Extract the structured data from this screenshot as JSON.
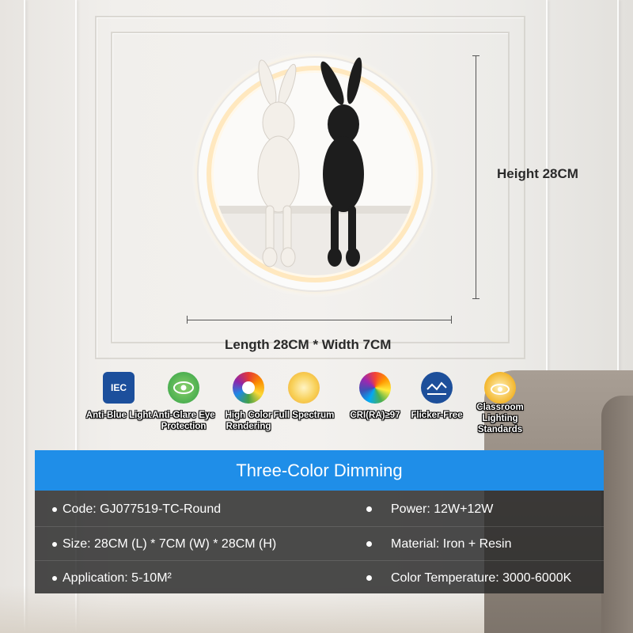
{
  "product": {
    "height_label": "Height 28CM",
    "size_label": "Length 28CM * Width 7CM"
  },
  "features": [
    {
      "icon": "iec-icon",
      "label": "Anti-Blue Light",
      "color": "#1c4f9c"
    },
    {
      "icon": "eye-protection-icon",
      "label": "Anti-Glare Eye Protection",
      "color": "#4caf50"
    },
    {
      "icon": "color-wheel-icon",
      "label": "High Color Rendering",
      "color": "#e91e63"
    },
    {
      "icon": "full-spectrum-sun-icon",
      "label": "Full Spectrum",
      "color": "#f5c33b"
    },
    {
      "icon": "cri-rainbow-icon",
      "label": "CRI(RA)≥97",
      "color": "#2fa7e0"
    },
    {
      "icon": "flicker-free-icon",
      "label": "Flicker-Free",
      "color": "#1d4f9a"
    },
    {
      "icon": "classroom-lighting-icon",
      "label": "Classroom Lighting Standards",
      "color": "#f3b62c"
    }
  ],
  "banner": {
    "title": "Three-Color Dimming",
    "color": "#1f8ee8"
  },
  "specs": {
    "code": "Code: GJ077519-TC-Round",
    "power": "Power: 12W+12W",
    "size": "Size: 28CM (L) * 7CM (W) * 28CM (H)",
    "material": "Material: Iron + Resin",
    "application": "Application: 5-10M²",
    "color_temperature": "Color Temperature: 3000-6000K"
  }
}
